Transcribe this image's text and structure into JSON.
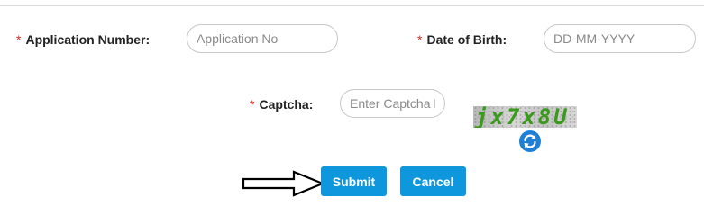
{
  "form": {
    "application_number": {
      "label": "Application Number:",
      "placeholder": "Application No",
      "value": ""
    },
    "date_of_birth": {
      "label": "Date of Birth:",
      "placeholder": "DD-MM-YYYY",
      "value": ""
    },
    "captcha": {
      "label": "Captcha:",
      "placeholder": "Enter Captcha Here",
      "value": "",
      "image_text": "jx7x8U"
    },
    "required_marker": "*"
  },
  "buttons": {
    "submit_label": "Submit",
    "cancel_label": "Cancel"
  },
  "icons": {
    "refresh": "refresh-icon",
    "pointer": "arrow-right-icon"
  },
  "colors": {
    "button": "#0e97dd",
    "required": "#d62c1a",
    "captcha_text": "#3a9a1c",
    "refresh": "#1e7fd6"
  }
}
